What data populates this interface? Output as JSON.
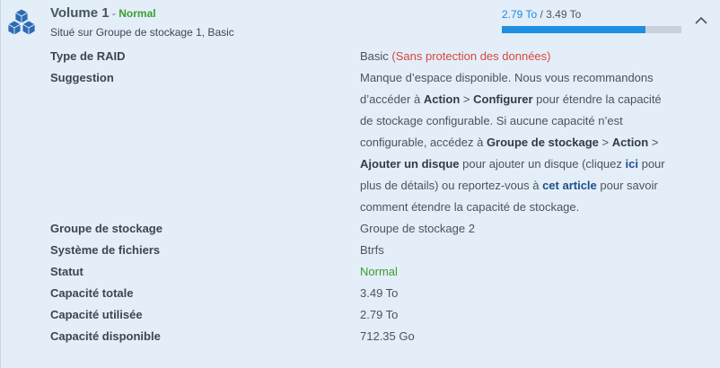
{
  "volume": {
    "name": "Volume 1",
    "separator": " - ",
    "status": "Normal",
    "location": "Situé sur Groupe de stockage 1, Basic",
    "icon": "volume-cubes-icon"
  },
  "usage": {
    "used": "2.79 To",
    "separator": " / ",
    "total": "3.49 To",
    "fraction": 0.8,
    "fill_color": "#1e8ee3"
  },
  "collapse_icon": "chevron-up-icon",
  "properties": {
    "raid_type": {
      "label": "Type de RAID",
      "value": "Basic",
      "warning": "(Sans protection des données)"
    },
    "suggestion": {
      "label": "Suggestion",
      "t1": "Manque d’espace disponible. Nous vous recommandons d’accéder à ",
      "b1": "Action",
      "t2": " > ",
      "b2": "Configurer",
      "t3": " pour étendre la capacité de stockage configurable. Si aucune capacité n’est configurable, accédez à ",
      "b3": "Groupe de stockage",
      "t4": " > ",
      "b4": "Action",
      "t5": " > ",
      "b5": "Ajouter un disque",
      "t6": " pour ajouter un disque (cliquez ",
      "link1": "ici",
      "t7": " pour plus de détails) ou reportez-vous à ",
      "link2": "cet article",
      "t8": " pour savoir comment étendre la capacité de stockage."
    },
    "storage_pool": {
      "label": "Groupe de stockage",
      "value": "Groupe de stockage 2"
    },
    "file_system": {
      "label": "Système de fichiers",
      "value": "Btrfs"
    },
    "status": {
      "label": "Statut",
      "value": "Normal"
    },
    "total_capacity": {
      "label": "Capacité totale",
      "value": "3.49 To"
    },
    "used_capacity": {
      "label": "Capacité utilisée",
      "value": "2.79 To"
    },
    "available_capacity": {
      "label": "Capacité disponible",
      "value": "712.35 Go"
    }
  }
}
